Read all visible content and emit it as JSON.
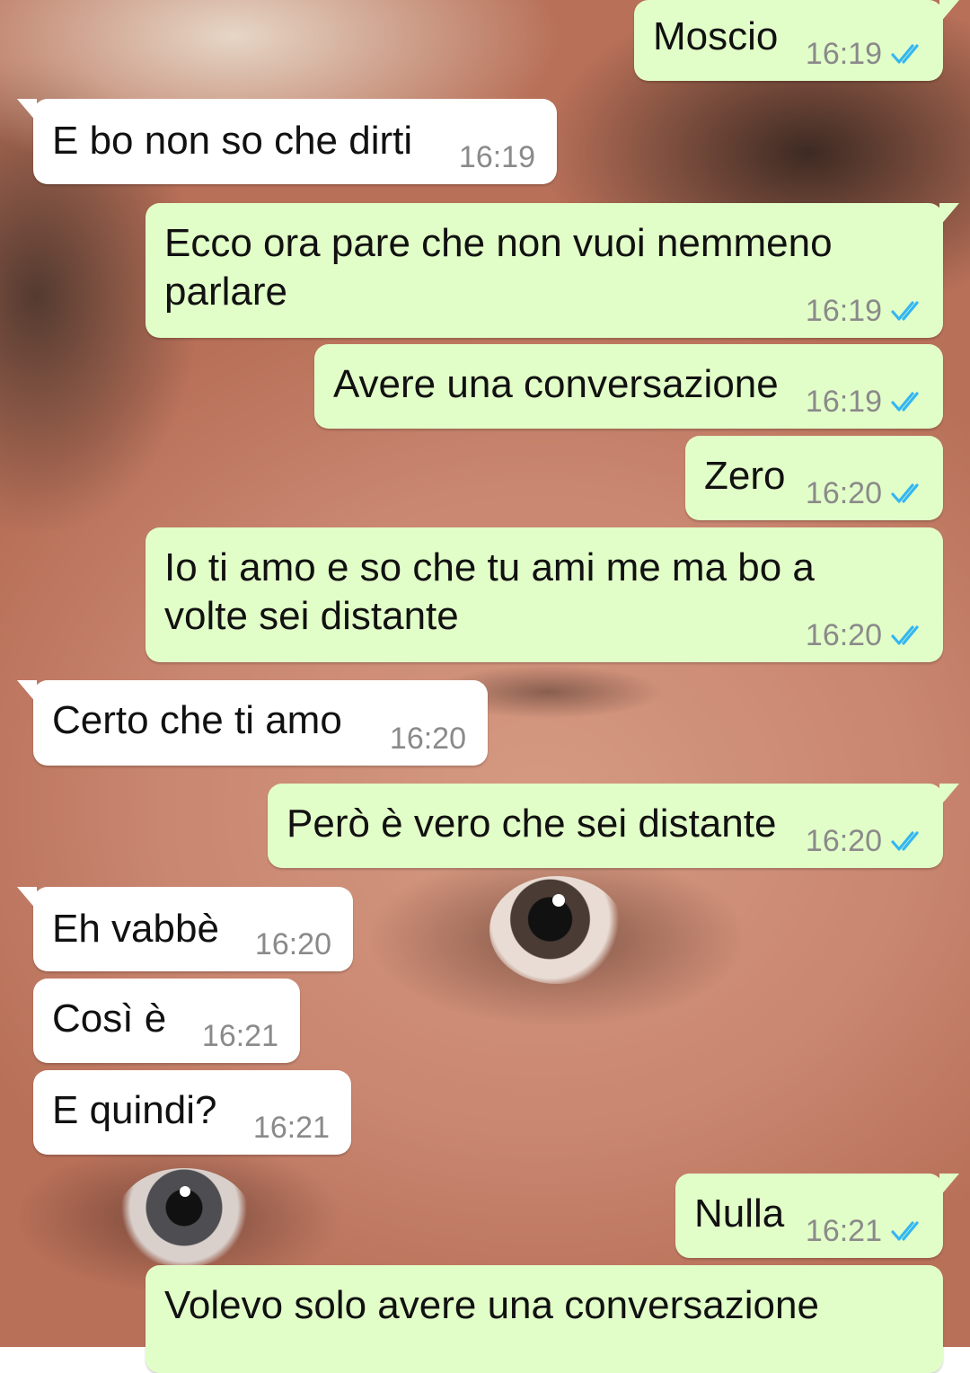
{
  "chat": {
    "colors": {
      "incoming": "#ffffff",
      "outgoing": "#e2fec8",
      "tick": "#34b7f1",
      "time": "#8a8a8a"
    },
    "messages": [
      {
        "dir": "out",
        "text": "Moscio",
        "time": "16:19",
        "status_icon": "double-check-icon"
      },
      {
        "dir": "in",
        "text": "E bo non so che dirti",
        "time": "16:19"
      },
      {
        "dir": "out",
        "text": "Ecco ora pare che non vuoi nemmeno\nparlare",
        "time": "16:19",
        "status_icon": "double-check-icon"
      },
      {
        "dir": "out",
        "text": "Avere una conversazione",
        "time": "16:19",
        "status_icon": "double-check-icon"
      },
      {
        "dir": "out",
        "text": "Zero",
        "time": "16:20",
        "status_icon": "double-check-icon"
      },
      {
        "dir": "out",
        "text": "Io ti amo e so che tu ami me ma bo a\nvolte sei distante",
        "time": "16:20",
        "status_icon": "double-check-icon"
      },
      {
        "dir": "in",
        "text": "Certo che ti amo",
        "time": "16:20"
      },
      {
        "dir": "out",
        "text": "Però è vero che sei distante",
        "time": "16:20",
        "status_icon": "double-check-icon"
      },
      {
        "dir": "in",
        "text": "Eh vabbè",
        "time": "16:20"
      },
      {
        "dir": "in",
        "text": "Così è",
        "time": "16:21"
      },
      {
        "dir": "in",
        "text": "E quindi?",
        "time": "16:21"
      },
      {
        "dir": "out",
        "text": "Nulla",
        "time": "16:21",
        "status_icon": "double-check-icon"
      },
      {
        "dir": "out",
        "text": "Volevo solo avere una conversazione",
        "time": ""
      }
    ]
  }
}
